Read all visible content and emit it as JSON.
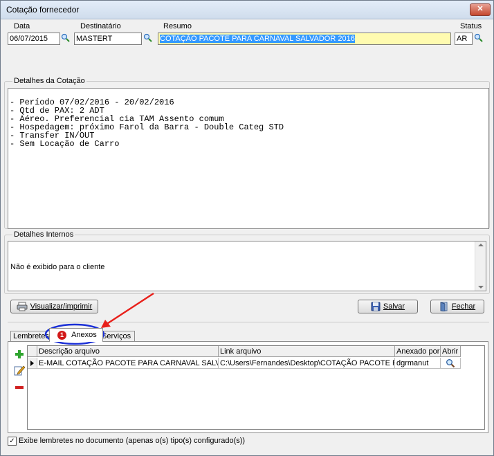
{
  "window": {
    "title": "Cotação fornecedor",
    "close_label": "✕"
  },
  "header": {
    "data_label": "Data",
    "data_value": "06/07/2015",
    "destinatario_label": "Destinatário",
    "destinatario_value": "MASTERT",
    "resumo_label": "Resumo",
    "resumo_value": "COTAÇÃO PACOTE PARA CARNAVAL SALVADOR 2016",
    "status_label": "Status",
    "status_value": "AR"
  },
  "detalhes": {
    "label": "Detalhes da Cotação",
    "text": "\n- Período 07/02/2016 - 20/02/2016\n- Qtd de PAX: 2 ADT\n- Aéreo. Preferencial cia TAM Assento comum\n- Hospedagem: próximo Farol da Barra - Double Categ STD\n- Transfer IN/OUT\n- Sem Locação de Carro"
  },
  "internos": {
    "label": "Detalhes Internos",
    "text": "Não é exibido para o cliente"
  },
  "buttons": {
    "visualizar": "Visualizar/imprimir",
    "salvar": "Salvar",
    "fechar": "Fechar"
  },
  "tabs": {
    "lembretes": "Lembretes",
    "anexos": "Anexos",
    "anexos_badge": "1",
    "servicos": "Serviços"
  },
  "anexos_table": {
    "columns": [
      "Descrição arquivo",
      "Link arquivo",
      "Anexado por",
      "Abrir"
    ],
    "rows": [
      {
        "descricao": "E-MAIL COTAÇÃO PACOTE PARA CARNAVAL SALV...",
        "link": "C:\\Users\\Fernandes\\Desktop\\COTAÇÃO PACOTE F...",
        "anexado": "dgrmanut"
      }
    ]
  },
  "footer": {
    "checkbox_label": "Exibe lembretes no documento (apenas o(s) tipo(s) configurado(s))",
    "checked": true
  },
  "colors": {
    "highlight_field": "#fffbb0",
    "selection": "#3399ff",
    "annotation_red": "#e8201a",
    "annotation_blue": "#1a2fd6"
  }
}
